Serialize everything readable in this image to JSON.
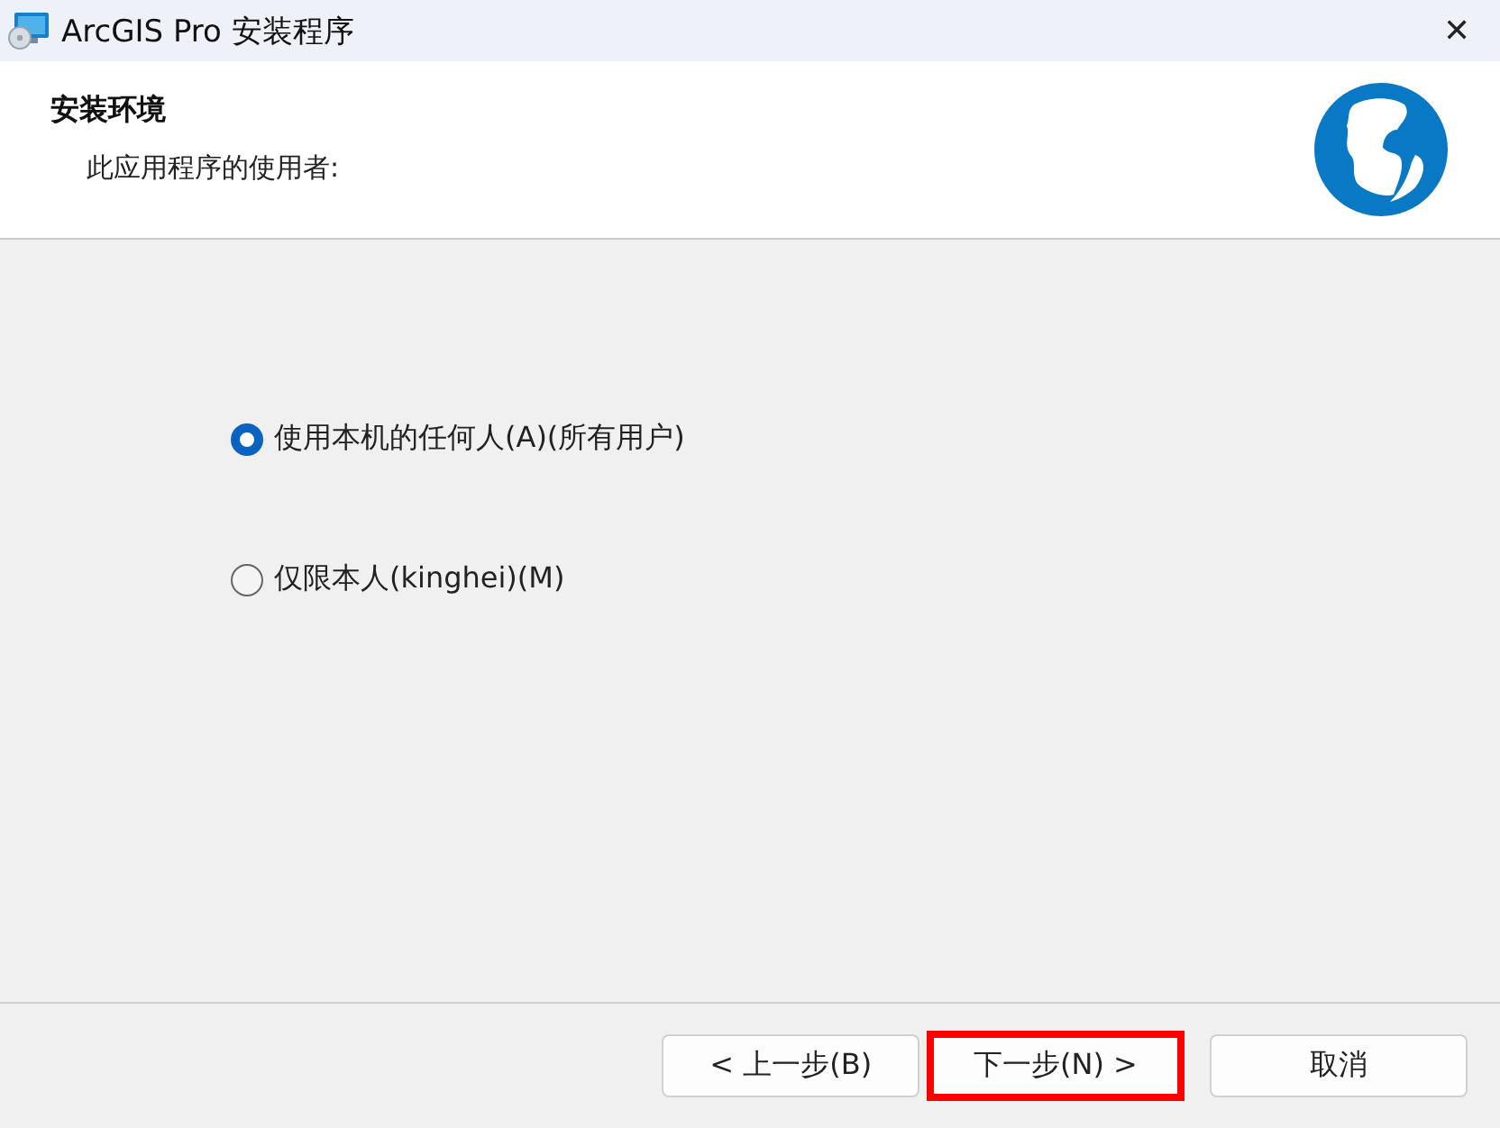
{
  "window": {
    "title": "ArcGIS Pro 安装程序",
    "close": "✕"
  },
  "header": {
    "title": "安装环境",
    "subtitle": "此应用程序的使用者:"
  },
  "options": [
    {
      "label": "使用本机的任何人(A)(所有用户)",
      "selected": true
    },
    {
      "label": "仅限本人(kinghei)(M)",
      "selected": false
    }
  ],
  "buttons": [
    {
      "label": "< 上一步(B)",
      "highlighted": false
    },
    {
      "label": "下一步(N) >",
      "highlighted": true
    },
    {
      "label": "取消",
      "highlighted": false
    }
  ]
}
